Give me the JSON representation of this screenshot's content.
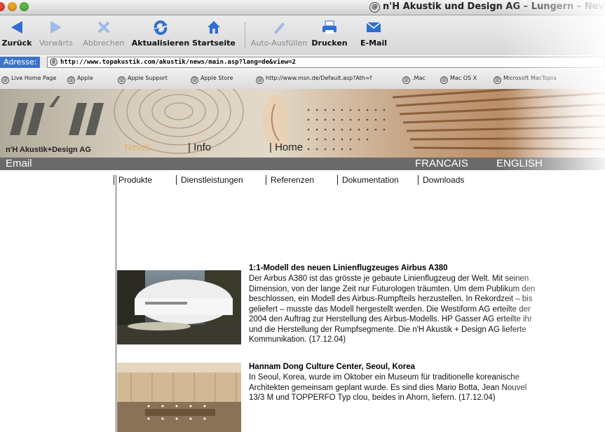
{
  "window": {
    "title": "n'H Akustik und Design AG – Lungern – Nev"
  },
  "toolbar": {
    "back": "Zurück",
    "forward": "Vorwärts",
    "stop": "Abbrechen",
    "refresh": "Aktualisieren",
    "home": "Startseite",
    "autofill": "Auto-Ausfüllen",
    "print": "Drucken",
    "mail": "E-Mail"
  },
  "address": {
    "label": "Adresse:",
    "url": "http://www.topakustik.com/akustik/news/main.asp?lang=de&view=2"
  },
  "favorites": [
    "Live Home Page",
    "Apple",
    "Apple Support",
    "Apple Store",
    "http://www.msn.de/Default.asp?Ath=f",
    ".Mac",
    "Mac OS X",
    "Microsoft MacTopia"
  ],
  "site": {
    "name": "n'H Akustik+Design AG",
    "nav": {
      "news": "News",
      "info": "| Info",
      "home": "| Home"
    },
    "strip": {
      "email": "Email",
      "francais": "FRANCAIS",
      "english": "ENGLISH"
    },
    "menu": [
      "Produkte",
      "Dienstleistungen",
      "Referenzen",
      "Dokumentation",
      "Downloads"
    ]
  },
  "articles": [
    {
      "title": "1:1-Modell des neuen Linienflugzeuges Airbus A380",
      "lines": [
        "Der Airbus A380 ist das grösste je gebaute Linienflugzeug der Welt. Mit seinen",
        "Dimension, von der lange Zeit nur Futurologen träumten. Um dem Publikum den",
        "beschlossen, ein Modell des Airbus-Rumpfteils herzustellen. In Rekordzeit – bis",
        "geliefert – musste das Modell hergestellt werden. Die Westiform AG erteilte der",
        "2004 den Auftrag zur Herstellung des Airbus-Modells. HP Gasser AG erteilte ihr",
        "und die Herstellung der Rumpfsegmente. Die n'H Akustik + Design AG lieferte",
        "Kommunikation. (17.12.04)"
      ]
    },
    {
      "title": "Hannam Dong Culture Center, Seoul, Korea",
      "lines": [
        "In Seoul, Korea, wurde im Oktober ein Museum für traditionelle koreanische",
        "Architekten gemeinsam geplant wurde. Es sind dies Mario Botta, Jean Nouvel",
        "13/3 M und TOPPERFO Typ clou, beides in Ahorn, liefern. (17.12.04)"
      ]
    }
  ]
}
